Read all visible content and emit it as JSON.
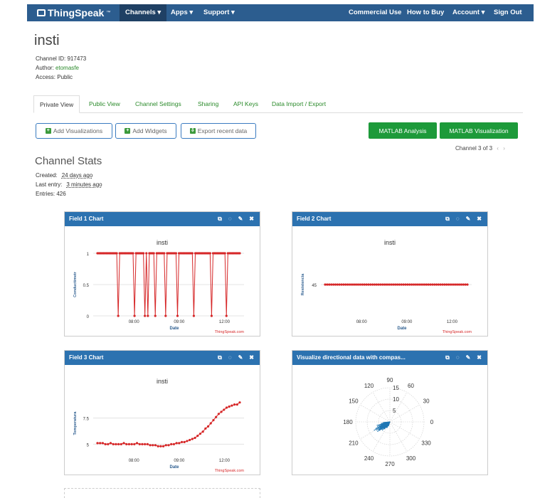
{
  "nav": {
    "brand": "ThingSpeak",
    "brand_tm": "™",
    "items_left": [
      "Channels ▾",
      "Apps ▾",
      "Support ▾"
    ],
    "items_right": [
      "Commercial Use",
      "How to Buy",
      "Account ▾",
      "Sign Out"
    ]
  },
  "channel": {
    "title": "insti",
    "id_label": "Channel ID: 917473",
    "author_label": "Author:",
    "author": "etomasfe",
    "access_label": "Access: Public"
  },
  "tabs": [
    "Private View",
    "Public View",
    "Channel Settings",
    "Sharing",
    "API Keys",
    "Data Import / Export"
  ],
  "buttons": {
    "add_visualizations": "Add Visualizations",
    "add_widgets": "Add Widgets",
    "export": "Export recent data",
    "matlab_analysis": "MATLAB Analysis",
    "matlab_visualization": "MATLAB Visualization"
  },
  "pager": {
    "text": "Channel 3 of 3"
  },
  "stats": {
    "title": "Channel Stats",
    "created_label": "Created:",
    "created": "24 days ago",
    "last_entry_label": "Last entry:",
    "last_entry": "3 minutes ago",
    "entries": "Entries: 426"
  },
  "widgets": [
    {
      "title": "Field 1 Chart"
    },
    {
      "title": "Field 2 Chart"
    },
    {
      "title": "Field 3 Chart"
    },
    {
      "title": "Visualize directional data with compas..."
    }
  ],
  "chart_data": [
    {
      "type": "line",
      "title": "insti",
      "xlabel": "Date",
      "ylabel": "Conductimetr",
      "x_ticks": [
        "08:00",
        "09:00",
        "12:00"
      ],
      "y_ticks": [
        "0",
        "0.5",
        "1"
      ],
      "ylim": [
        0,
        1
      ],
      "values": [
        1,
        1,
        1,
        1,
        1,
        1,
        1,
        1,
        1,
        1,
        1,
        1,
        1,
        1,
        0,
        1,
        1,
        1,
        1,
        1,
        1,
        1,
        1,
        1,
        1,
        0,
        1,
        1,
        1,
        1,
        1,
        1,
        0,
        1,
        0,
        1,
        1,
        1,
        1,
        0,
        1,
        1,
        1,
        1,
        1,
        1,
        0,
        1,
        1,
        1,
        1,
        1,
        1,
        1,
        0,
        1,
        1,
        1,
        1,
        1,
        1,
        1,
        1,
        1,
        1,
        0,
        1,
        1,
        1,
        1,
        1,
        1,
        1,
        1,
        1,
        1,
        1,
        0,
        1,
        1,
        1,
        1,
        1,
        1,
        1,
        1,
        1,
        0,
        1,
        1,
        1,
        1,
        1,
        1,
        1,
        1,
        1
      ],
      "color": "#d62728",
      "credit": "ThingSpeak.com"
    },
    {
      "type": "line",
      "title": "insti",
      "xlabel": "Date",
      "ylabel": "Resistencia",
      "x_ticks": [
        "08:00",
        "09:00",
        "12:00"
      ],
      "y_ticks": [
        "45"
      ],
      "ylim": [
        40,
        50
      ],
      "values": [
        45,
        45,
        45,
        45,
        45,
        45,
        45,
        45,
        45,
        45,
        45,
        45,
        45,
        45,
        45,
        45,
        45,
        45,
        45,
        45,
        45,
        45,
        45,
        45,
        45,
        45,
        45,
        45,
        45,
        45,
        45,
        45,
        45,
        45,
        45,
        45,
        45,
        45,
        45,
        45,
        45,
        45,
        45,
        45,
        45,
        45,
        45,
        45,
        45,
        45,
        45,
        45,
        45,
        45,
        45,
        45,
        45,
        45,
        45,
        45,
        45,
        45,
        45,
        45,
        45,
        45,
        45,
        45,
        45,
        45
      ],
      "color": "#d62728",
      "credit": "ThingSpeak.com"
    },
    {
      "type": "line",
      "title": "insti",
      "xlabel": "Date",
      "ylabel": "Temperatura",
      "x_ticks": [
        "08:00",
        "09:00",
        "12:00"
      ],
      "y_ticks": [
        "5",
        "7.5"
      ],
      "ylim": [
        4,
        10
      ],
      "values": [
        5.1,
        5.1,
        5.1,
        5.0,
        5.0,
        5.1,
        5.0,
        5.0,
        5.0,
        5.0,
        5.1,
        5.0,
        5.0,
        5.0,
        5.0,
        5.1,
        5.0,
        5.0,
        5.0,
        5.0,
        4.9,
        4.9,
        4.9,
        4.8,
        4.8,
        4.8,
        4.9,
        4.9,
        5.0,
        5.0,
        5.1,
        5.1,
        5.2,
        5.2,
        5.3,
        5.4,
        5.5,
        5.6,
        5.8,
        6.0,
        6.2,
        6.5,
        6.7,
        7.0,
        7.3,
        7.6,
        7.9,
        8.1,
        8.3,
        8.5,
        8.6,
        8.7,
        8.8,
        8.8,
        9.0
      ],
      "color": "#d62728",
      "credit": "ThingSpeak.com"
    },
    {
      "type": "compass",
      "angle_labels": [
        "90",
        "120",
        "150",
        "180",
        "210",
        "240",
        "270",
        "300",
        "330",
        "0",
        "30",
        "60"
      ],
      "radial_labels": [
        "5",
        "10",
        "15"
      ],
      "rmax": 15,
      "color": "#1f77b4",
      "vectors": [
        {
          "angle": 185,
          "r": 3
        },
        {
          "angle": 190,
          "r": 4
        },
        {
          "angle": 195,
          "r": 5
        },
        {
          "angle": 198,
          "r": 4
        },
        {
          "angle": 200,
          "r": 6
        },
        {
          "angle": 203,
          "r": 5
        },
        {
          "angle": 205,
          "r": 7
        },
        {
          "angle": 207,
          "r": 6
        },
        {
          "angle": 210,
          "r": 5
        },
        {
          "angle": 212,
          "r": 7
        },
        {
          "angle": 215,
          "r": 6
        },
        {
          "angle": 218,
          "r": 5
        },
        {
          "angle": 220,
          "r": 6
        },
        {
          "angle": 223,
          "r": 5
        },
        {
          "angle": 225,
          "r": 4
        },
        {
          "angle": 228,
          "r": 5
        },
        {
          "angle": 230,
          "r": 4
        },
        {
          "angle": 233,
          "r": 4
        },
        {
          "angle": 236,
          "r": 3
        },
        {
          "angle": 240,
          "r": 3
        },
        {
          "angle": 244,
          "r": 3
        },
        {
          "angle": 248,
          "r": 2
        },
        {
          "angle": 252,
          "r": 2
        },
        {
          "angle": 195,
          "r": 6
        },
        {
          "angle": 208,
          "r": 8
        },
        {
          "angle": 213,
          "r": 6
        },
        {
          "angle": 218,
          "r": 7
        },
        {
          "angle": 202,
          "r": 4
        }
      ]
    }
  ]
}
